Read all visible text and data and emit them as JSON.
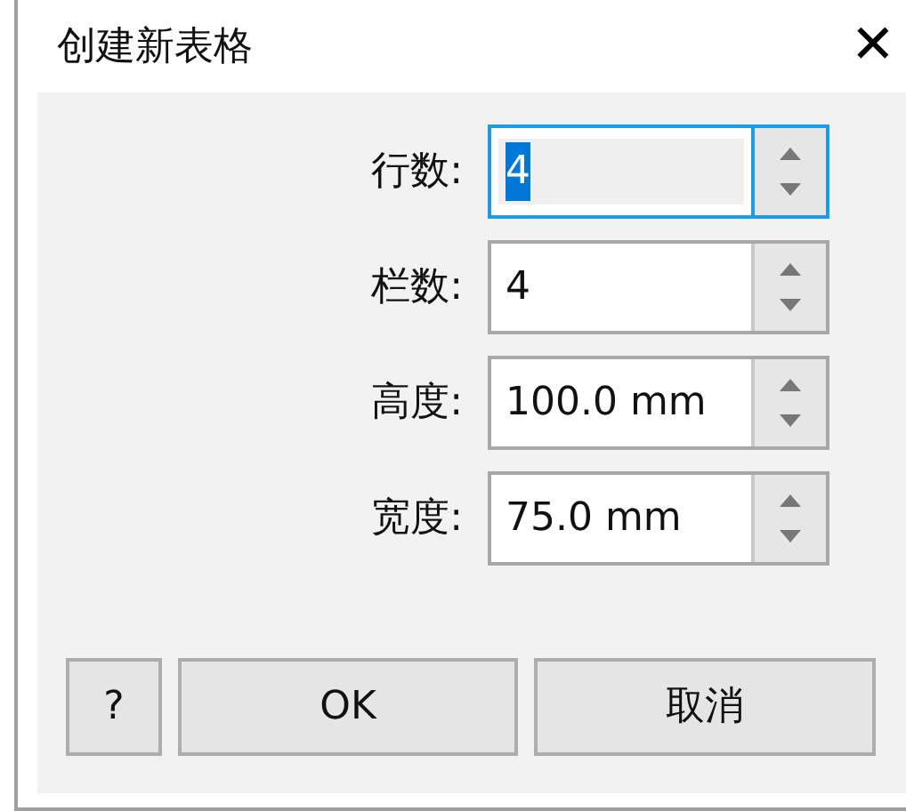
{
  "window": {
    "title": "创建新表格",
    "close": "✕"
  },
  "fields": [
    {
      "label": "行数:",
      "value": "4",
      "focused": true
    },
    {
      "label": "栏数:",
      "value": "4",
      "focused": false
    },
    {
      "label": "高度:",
      "value": "100.0 mm",
      "focused": false
    },
    {
      "label": "宽度:",
      "value": "75.0 mm",
      "focused": false
    }
  ],
  "buttons": [
    {
      "kind": "help",
      "label": "?"
    },
    {
      "kind": "ok",
      "label": "OK"
    },
    {
      "kind": "cancel",
      "label": "取消"
    }
  ]
}
